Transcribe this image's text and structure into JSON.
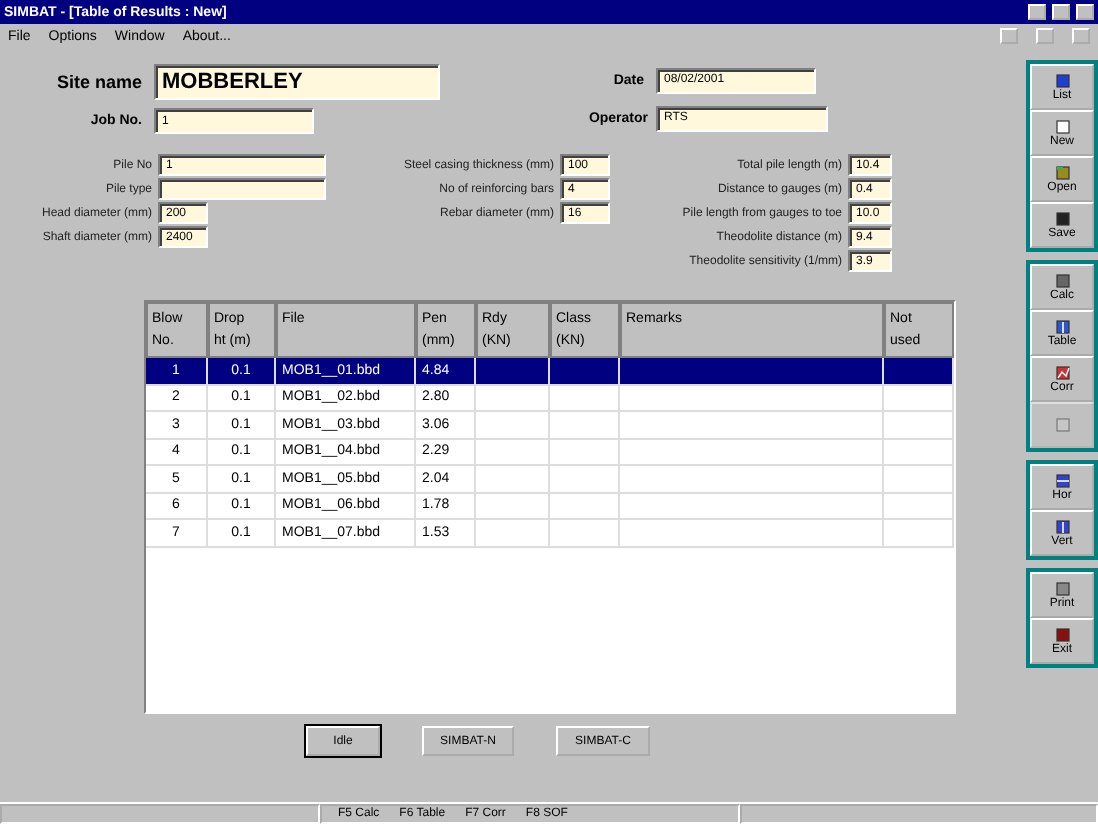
{
  "window": {
    "title": "SIMBAT - [Table of Results : New]"
  },
  "menu": [
    "File",
    "Options",
    "Window",
    "About..."
  ],
  "header": {
    "site_name": {
      "label": "Site name",
      "value": "MOBBERLEY"
    },
    "job_no": {
      "label": "Job No.",
      "value": "1"
    },
    "date": {
      "label": "Date",
      "value": "08/02/2001"
    },
    "operator": {
      "label": "Operator",
      "value": "RTS"
    }
  },
  "params": [
    [
      {
        "label": "Pile No",
        "value": "1"
      },
      {
        "label": "Pile type"
      },
      {
        "label": "Head diameter (mm)",
        "value": "200"
      },
      {
        "label": "Shaft diameter (mm)",
        "value": "2400"
      }
    ],
    [
      {
        "label": "Steel casing thickness (mm)",
        "value": "100"
      },
      {
        "label": "No of reinforcing bars",
        "value": "4"
      },
      {
        "label": "Rebar diameter (mm)",
        "value": "16"
      }
    ],
    [
      {
        "label": "Total pile length (m)",
        "value": "10.4"
      },
      {
        "label": "Distance to gauges (m)",
        "value": "0.4"
      },
      {
        "label": "Pile length from gauges to toe",
        "value": "10.0"
      },
      {
        "label": "Theodolite distance (m)",
        "value": "9.4"
      },
      {
        "label": "Theodolite sensitivity (1/mm)",
        "value": "3.9"
      }
    ]
  ],
  "table": {
    "columns": [
      "Blow\nNo.",
      "Drop\nht (m)",
      "File",
      "Pen\n(mm)",
      "Rdy\n(KN)",
      "Class\n(KN)",
      "Remarks",
      "Not\nused"
    ],
    "rows": [
      {
        "cells": [
          "1",
          "0.1",
          "MOB1__01.bbd",
          "4.84"
        ],
        "selected": true
      },
      {
        "cells": [
          "2",
          "0.1",
          "MOB1__02.bbd",
          "2.80"
        ],
        "selected": false
      },
      {
        "cells": [
          "3",
          "0.1",
          "MOB1__03.bbd",
          "3.06"
        ],
        "selected": false
      },
      {
        "cells": [
          "4",
          "0.1",
          "MOB1__04.bbd",
          "2.29"
        ],
        "selected": false
      },
      {
        "cells": [
          "5",
          "0.1",
          "MOB1__05.bbd",
          "2.04"
        ],
        "selected": false
      },
      {
        "cells": [
          "6",
          "0.1",
          "MOB1__06.bbd",
          "1.78"
        ],
        "selected": false
      },
      {
        "cells": [
          "7",
          "0.1",
          "MOB1__07.bbd",
          "1.53"
        ],
        "selected": false
      }
    ]
  },
  "buttons": [
    {
      "label": "Idle",
      "selected": true
    },
    {
      "label": "SIMBAT-N",
      "selected": false
    },
    {
      "label": "SIMBAT-C",
      "selected": false
    }
  ],
  "toolbar": [
    [
      {
        "kind": "list",
        "label": "List",
        "disabled": false
      },
      {
        "kind": "new",
        "label": "New",
        "disabled": false
      },
      {
        "kind": "open",
        "label": "Open",
        "disabled": false
      },
      {
        "kind": "save",
        "label": "Save",
        "disabled": false
      }
    ],
    [
      {
        "kind": "calc",
        "label": "Calc",
        "disabled": false
      },
      {
        "kind": "table",
        "label": "Table",
        "disabled": false
      },
      {
        "kind": "chart",
        "label": "Corr",
        "disabled": false
      },
      {
        "kind": "blank",
        "disabled": true
      }
    ],
    [
      {
        "kind": "hor",
        "label": "Hor",
        "disabled": false
      },
      {
        "kind": "vert",
        "label": "Vert",
        "disabled": false
      }
    ],
    [
      {
        "kind": "print",
        "label": "Print",
        "disabled": false
      },
      {
        "kind": "exit",
        "label": "Exit",
        "disabled": false
      }
    ]
  ],
  "status_bar": [
    "F5 Calc",
    "F6 Table",
    "F7 Corr",
    "F8 SOF"
  ]
}
